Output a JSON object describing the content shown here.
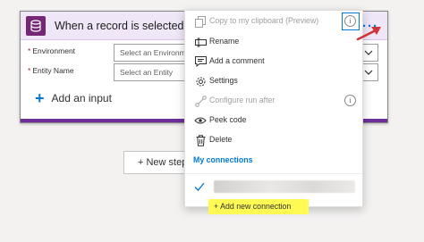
{
  "trigger_card": {
    "title": "When a record is selected",
    "fields": [
      {
        "required_mark": "*",
        "label": "Environment",
        "placeholder": "Select an Environme"
      },
      {
        "required_mark": "*",
        "label": "Entity Name",
        "placeholder": "Select an Entity"
      }
    ],
    "add_input_label": "Add an input",
    "ellipsis_label": "···",
    "header_color": "#efe7f7",
    "accent_color": "#6e2f9b"
  },
  "new_step_label": "+ New step",
  "menu": {
    "items": [
      {
        "label": "Copy to my clipboard (Preview)",
        "icon": "copy-icon",
        "disabled": true,
        "info": true
      },
      {
        "label": "Rename",
        "icon": "rename-icon",
        "disabled": false
      },
      {
        "label": "Add a comment",
        "icon": "comment-icon",
        "disabled": false
      },
      {
        "label": "Settings",
        "icon": "gear-icon",
        "disabled": false
      },
      {
        "label": "Configure run after",
        "icon": "run-after-icon",
        "disabled": true,
        "info": true
      },
      {
        "label": "Peek code",
        "icon": "eye-icon",
        "disabled": false
      },
      {
        "label": "Delete",
        "icon": "trash-icon",
        "disabled": false
      }
    ],
    "connections_title": "My connections",
    "add_connection_label": "+ Add new connection",
    "highlight_color": "#fffb54"
  }
}
